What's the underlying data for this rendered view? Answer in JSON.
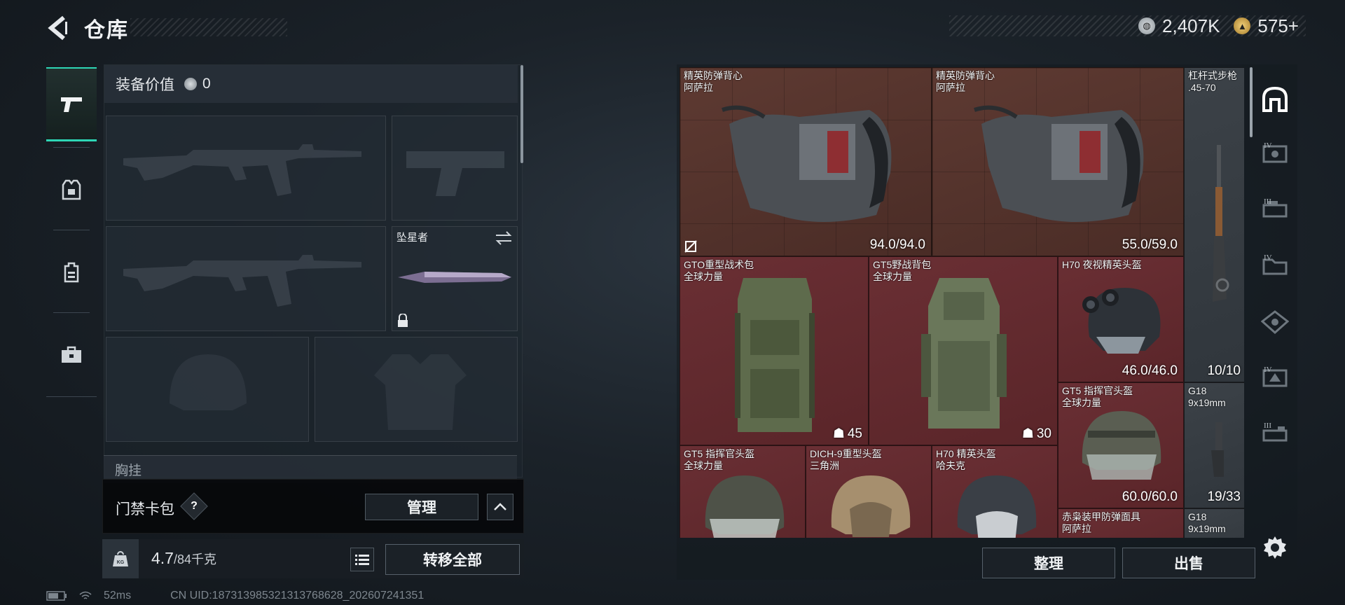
{
  "header": {
    "title": "仓库",
    "currency_silver": "2,407K",
    "currency_gold": "575+"
  },
  "categories": [
    {
      "name": "weapon",
      "icon": "pistol-icon",
      "active": true
    },
    {
      "name": "armor",
      "icon": "armor-icon",
      "active": false
    },
    {
      "name": "backpack",
      "icon": "backpack-icon",
      "active": false
    },
    {
      "name": "tools",
      "icon": "toolbox-icon",
      "active": false
    }
  ],
  "loadout": {
    "value_label": "装备价值",
    "value": "0",
    "melee_name": "坠星者",
    "chest_label": "胸挂"
  },
  "keycard": {
    "label": "门禁卡包",
    "help": "?",
    "manage": "管理"
  },
  "weight": {
    "current": "4.7",
    "max": "/84千克",
    "icon_text": "KG",
    "transfer_all": "转移全部"
  },
  "status": {
    "ping": "52ms",
    "uid": "CN UID:187313985321313768628_202607241351"
  },
  "stash": {
    "items": [
      {
        "name": "精英防弹背心",
        "sub": "阿萨拉",
        "value": "94.0/94.0",
        "color": "#5e3a32"
      },
      {
        "name": "精英防弹背心",
        "sub": "阿萨拉",
        "value": "55.0/59.0",
        "color": "#5e3a32"
      },
      {
        "name": "杠杆式步枪",
        "sub": ".45-70",
        "value": "10/10",
        "color": "#3c4248"
      },
      {
        "name": "GTO重型战术包",
        "sub": "全球力量",
        "value": "45",
        "color": "#6a2f34"
      },
      {
        "name": "GT5野战背包",
        "sub": "全球力量",
        "value": "30",
        "color": "#6a2f34"
      },
      {
        "name": "H70 夜视精英头盔",
        "sub": "",
        "value": "46.0/46.0",
        "color": "#6a2f34"
      },
      {
        "name": "G18",
        "sub": "9x19mm",
        "value": "19/33",
        "color": "#3c4248"
      },
      {
        "name": "GT5 指挥官头盔",
        "sub": "全球力量",
        "value": "60.0/60.0",
        "color": "#6a2f34"
      },
      {
        "name": "GT5 指挥官头盔",
        "sub": "全球力量",
        "value": "",
        "color": "#6a2f34"
      },
      {
        "name": "DICH-9重型头盔",
        "sub": "三角洲",
        "value": "",
        "color": "#6a2f34"
      },
      {
        "name": "H70 精英头盔",
        "sub": "哈夫克",
        "value": "",
        "color": "#6a2f34"
      },
      {
        "name": "赤枭装甲防弹面具",
        "sub": "阿萨拉",
        "value": "",
        "color": "#6a2f34"
      },
      {
        "name": "G18",
        "sub": "9x19mm",
        "value": "",
        "color": "#3c4248"
      }
    ],
    "filters": [
      "IV",
      "III",
      "IV",
      "",
      "IV",
      "III"
    ],
    "sort": "整理",
    "sell": "出售"
  },
  "colors": {
    "accent": "#2ed6b5",
    "legendary_bg": "#5e3a32",
    "epic_bg": "#6a2f34",
    "common_bg": "#3c4248"
  }
}
